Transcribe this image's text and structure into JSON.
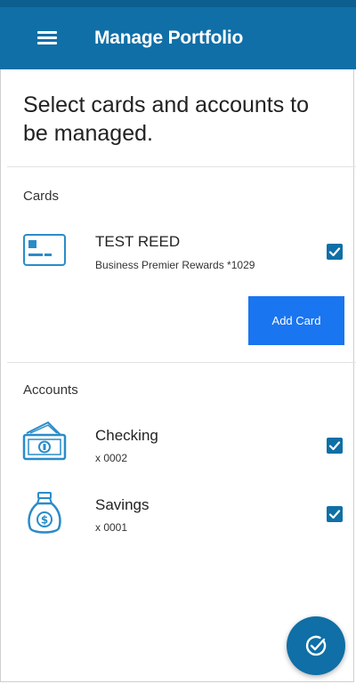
{
  "app": {
    "title": "Manage Portfolio",
    "menu_icon": "hamburger-menu-icon",
    "primary_color": "#0f6fa6",
    "accent_color": "#1a75f0"
  },
  "heading": "Select cards and accounts to be managed.",
  "cards_section": {
    "label": "Cards",
    "items": [
      {
        "icon": "credit-card-icon",
        "title": "TEST REED",
        "subtitle": "Business Premier Rewards *1029",
        "checked": true
      }
    ],
    "add_button_label": "Add Card"
  },
  "accounts_section": {
    "label": "Accounts",
    "items": [
      {
        "icon": "cash-stack-icon",
        "title": "Checking",
        "subtitle": "x 0002",
        "checked": true
      },
      {
        "icon": "money-bag-icon",
        "title": "Savings",
        "subtitle": "x 0001",
        "checked": true
      }
    ]
  },
  "fab": {
    "icon": "check-circle-icon"
  }
}
